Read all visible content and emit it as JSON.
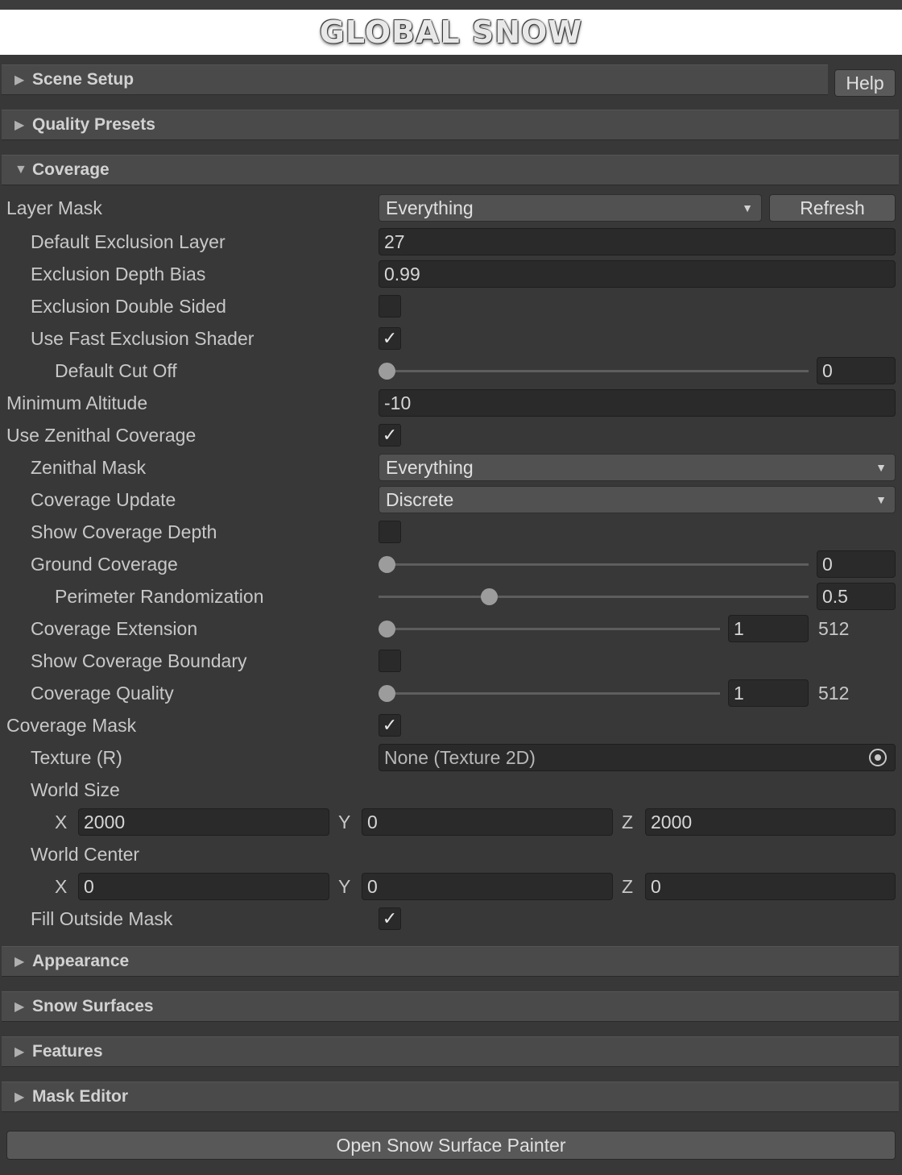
{
  "header": {
    "banner_title": "GLOBAL SNOW"
  },
  "sections": {
    "scene_setup": "Scene Setup",
    "quality_presets": "Quality Presets",
    "coverage": "Coverage",
    "appearance": "Appearance",
    "snow_surfaces": "Snow Surfaces",
    "features": "Features",
    "mask_editor": "Mask Editor"
  },
  "buttons": {
    "help": "Help",
    "refresh": "Refresh",
    "open_painter": "Open Snow Surface Painter"
  },
  "icons": {
    "collapsed": "triangle-right-icon",
    "expanded": "triangle-down-icon",
    "checkmark": "check-icon",
    "dropdown": "caret-down-icon",
    "object_picker": "object-picker-icon"
  },
  "coverage": {
    "layer_mask": {
      "label": "Layer Mask",
      "value": "Everything"
    },
    "default_exclusion_layer": {
      "label": "Default Exclusion Layer",
      "value": "27"
    },
    "exclusion_depth_bias": {
      "label": "Exclusion Depth Bias",
      "value": "0.99"
    },
    "exclusion_double_sided": {
      "label": "Exclusion Double Sided",
      "checked": false
    },
    "use_fast_exclusion_shader": {
      "label": "Use Fast Exclusion Shader",
      "checked": true
    },
    "default_cut_off": {
      "label": "Default Cut Off",
      "value": "0",
      "fraction": 0
    },
    "minimum_altitude": {
      "label": "Minimum Altitude",
      "value": "-10"
    },
    "use_zenithal_coverage": {
      "label": "Use Zenithal Coverage",
      "checked": true
    },
    "zenithal_mask": {
      "label": "Zenithal Mask",
      "value": "Everything"
    },
    "coverage_update": {
      "label": "Coverage Update",
      "value": "Discrete"
    },
    "show_coverage_depth": {
      "label": "Show Coverage Depth",
      "checked": false
    },
    "ground_coverage": {
      "label": "Ground Coverage",
      "value": "0",
      "fraction": 0
    },
    "perimeter_randomization": {
      "label": "Perimeter Randomization",
      "value": "0.5",
      "fraction": 0.5
    },
    "coverage_extension": {
      "label": "Coverage Extension",
      "value": "1",
      "suffix": "512",
      "fraction": 0
    },
    "show_coverage_boundary": {
      "label": "Show Coverage Boundary",
      "checked": false
    },
    "coverage_quality": {
      "label": "Coverage Quality",
      "value": "1",
      "suffix": "512",
      "fraction": 0
    },
    "coverage_mask": {
      "label": "Coverage Mask",
      "checked": true
    },
    "texture_r": {
      "label": "Texture (R)",
      "value": "None (Texture 2D)"
    },
    "world_size": {
      "label": "World Size",
      "x_label": "X",
      "y_label": "Y",
      "z_label": "Z",
      "x": "2000",
      "y": "0",
      "z": "2000"
    },
    "world_center": {
      "label": "World Center",
      "x_label": "X",
      "y_label": "Y",
      "z_label": "Z",
      "x": "0",
      "y": "0",
      "z": "0"
    },
    "fill_outside_mask": {
      "label": "Fill Outside Mask",
      "checked": true
    }
  }
}
